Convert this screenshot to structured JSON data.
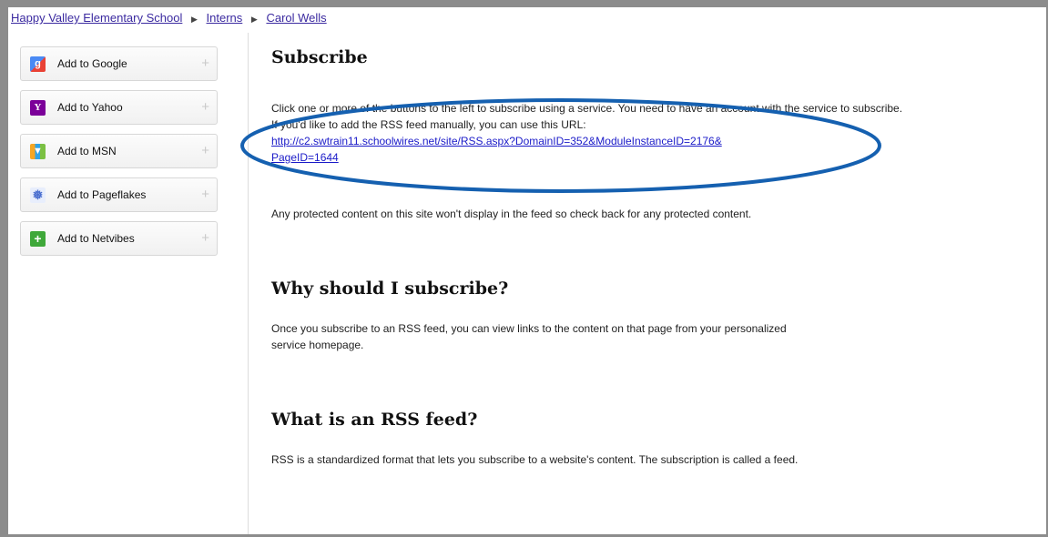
{
  "breadcrumb": {
    "items": [
      "Happy Valley Elementary School",
      "Interns",
      "Carol Wells"
    ]
  },
  "sidebar": {
    "items": [
      {
        "label": "Add to Google",
        "icon": "google-icon",
        "color": "#4a8af4"
      },
      {
        "label": "Add to Yahoo",
        "icon": "yahoo-icon",
        "color": "#7b0099"
      },
      {
        "label": "Add to MSN",
        "icon": "msn-icon",
        "color": "#f5a623"
      },
      {
        "label": "Add to Pageflakes",
        "icon": "pageflakes-icon",
        "color": "#4a6fd0"
      },
      {
        "label": "Add to Netvibes",
        "icon": "netvibes-icon",
        "color": "#3fa83a"
      }
    ]
  },
  "main": {
    "subscribe": {
      "heading": "Subscribe",
      "intro": "Click one or more of the buttons to the left to subscribe using a service. You need to have an account with the service to subscribe. If you'd like to add the RSS feed manually, you can use this URL:",
      "url_line1": "http://c2.swtrain11.schoolwires.net/site/RSS.aspx?DomainID=352&ModuleInstanceID=2176&",
      "url_line2": "PageID=1644",
      "note": "Any protected content on this site won't display in the feed so check back for any protected content."
    },
    "why": {
      "heading": "Why should I subscribe?",
      "text": "Once you subscribe to an RSS feed, you can view links to the content on that page from your personalized service homepage."
    },
    "what": {
      "heading": "What is an RSS feed?",
      "text": "RSS is a standardized format that lets you subscribe to a website's content. The subscription is called a feed."
    }
  },
  "annotation": {
    "color": "#1560b0"
  }
}
